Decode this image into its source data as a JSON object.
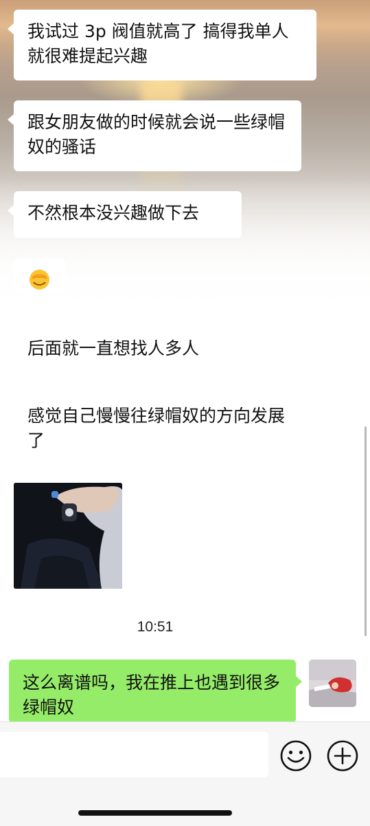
{
  "messages": {
    "received_1": "我试过 3p 阀值就高了 搞得我单人就很难提起兴趣",
    "received_2": "跟女朋友做的时候就会说一些绿帽奴的骚话",
    "received_3": "不然根本没兴趣做下去",
    "received_4_emoji": "face-palm-emoji",
    "received_5": "后面就一直想找人多人",
    "received_6": "感觉自己慢慢往绿帽奴的方向发展了",
    "received_7_image": "car-gear-shift-photo",
    "timestamp": "10:51",
    "sent_1": "这么离谱吗，我在推上也遇到很多绿帽奴"
  },
  "input_bar": {
    "message_value": "",
    "emoji_icon": "smiley-icon",
    "more_icon": "plus-circle-icon"
  },
  "colors": {
    "sent_bubble": "#95ec69",
    "received_bubble": "#ffffff",
    "input_bar_bg": "#f6f6f6"
  }
}
